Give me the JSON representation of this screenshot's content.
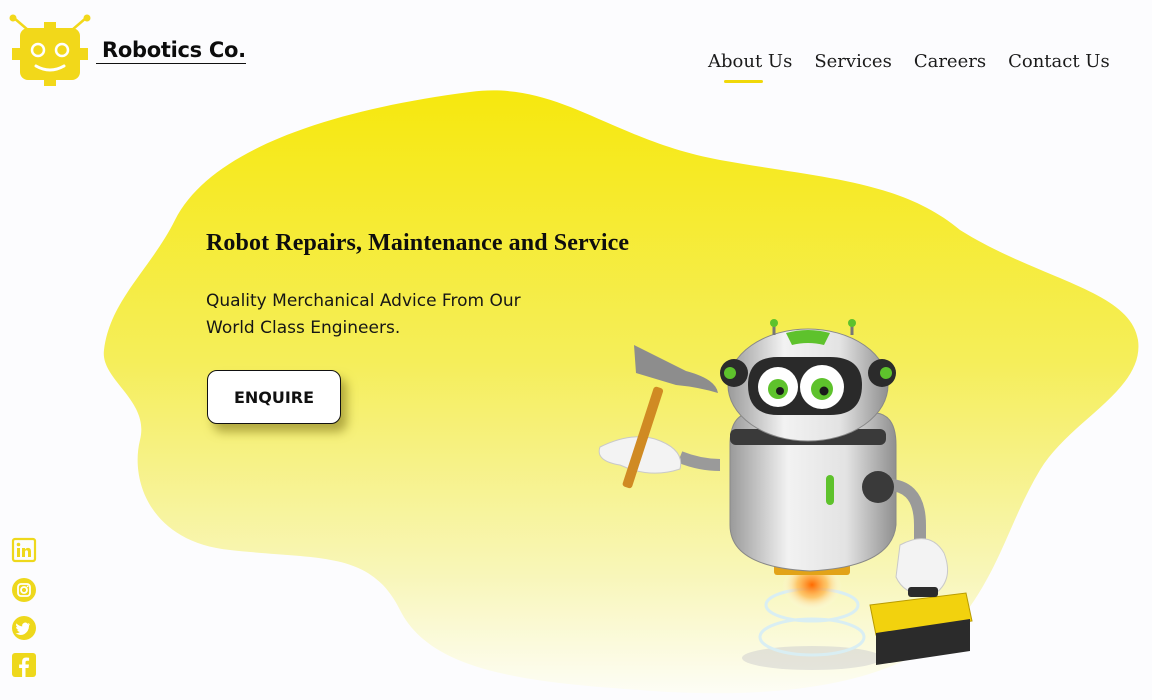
{
  "brand": {
    "name": "Robotics Co.",
    "logo_icon": "robot-gear-logo-icon"
  },
  "nav": {
    "items": [
      {
        "label": "About Us",
        "active": true
      },
      {
        "label": "Services",
        "active": false
      },
      {
        "label": "Careers",
        "active": false
      },
      {
        "label": "Contact Us",
        "active": false
      }
    ]
  },
  "hero": {
    "title": "Robot Repairs, Maintenance and Service",
    "subtitle_line1": "Quality Merchanical Advice From Our",
    "subtitle_line2": "World Class Engineers.",
    "cta_label": "ENQUIRE"
  },
  "social": [
    {
      "name": "linkedin-icon"
    },
    {
      "name": "instagram-icon"
    },
    {
      "name": "twitter-icon"
    },
    {
      "name": "facebook-icon"
    }
  ],
  "colors": {
    "accent": "#f4e400",
    "accent_light": "#f7f28a",
    "text": "#111111",
    "background": "#fcfcfe"
  }
}
